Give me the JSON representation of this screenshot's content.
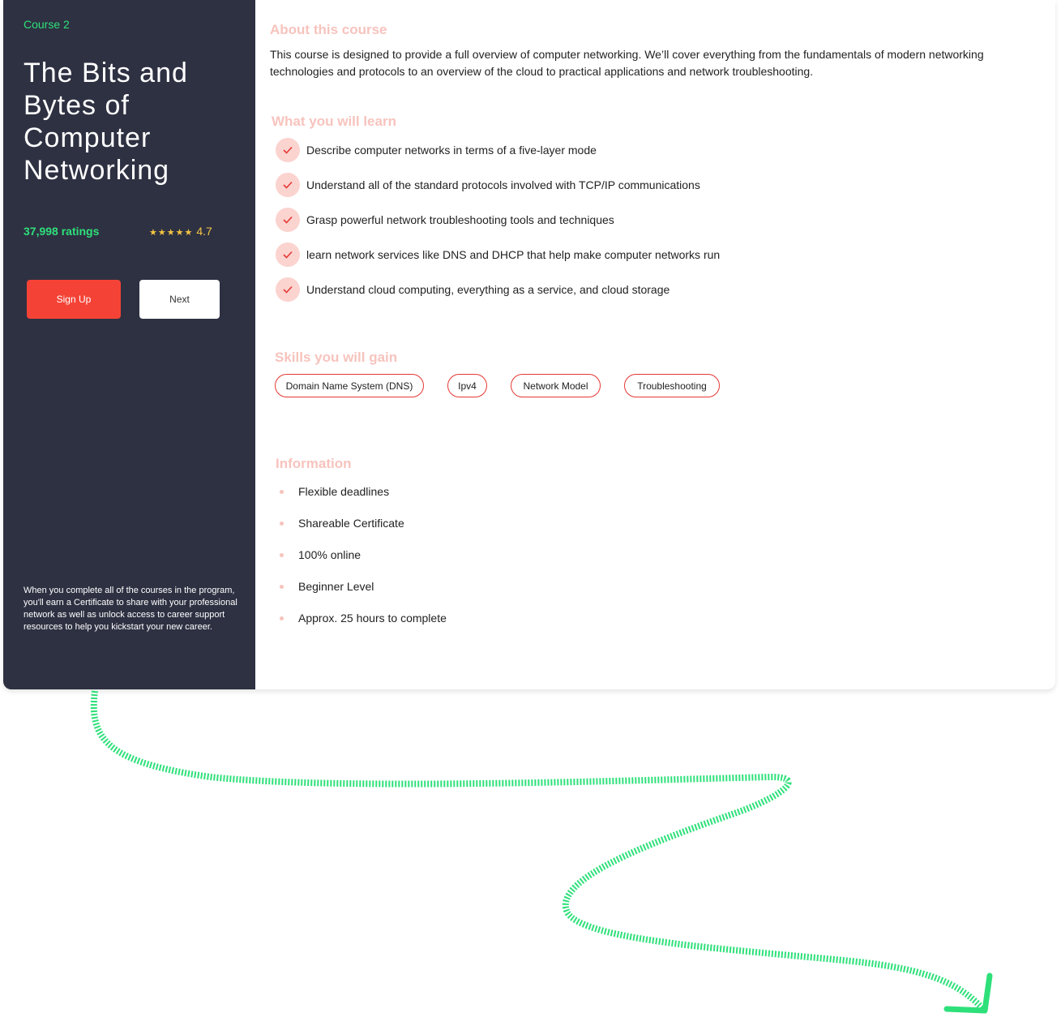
{
  "sidebar": {
    "course_label": "Course 2",
    "title": "The Bits and Bytes of Computer Networking",
    "ratings_count": "37,998 ratings",
    "stars": "★★★★★",
    "rating_value": "4.7",
    "signup_label": "Sign Up",
    "next_label": "Next",
    "footer_text": "When you complete all of the courses in the program, you'll earn a Certificate to share with your professional network as well as unlock access to career support resources to help you kickstart your new career."
  },
  "about": {
    "heading": "About this course",
    "text": "This course is designed to provide a full overview of computer networking. We’ll cover everything from the fundamentals of modern networking technologies and protocols to an overview of the cloud to practical applications and network troubleshooting."
  },
  "learn": {
    "heading": "What you will learn",
    "items": [
      "Describe computer networks in terms of a five-layer mode",
      "Understand all of the standard protocols involved with TCP/IP communications",
      "Grasp powerful network troubleshooting tools and techniques",
      "learn network services like DNS and DHCP that help make computer networks run",
      "Understand cloud computing, everything as a service, and cloud storage"
    ]
  },
  "skills": {
    "heading": "Skills you will gain",
    "items": [
      "Domain Name System (DNS)",
      "Ipv4",
      "Network Model",
      "Troubleshooting"
    ]
  },
  "information": {
    "heading": "Information",
    "items": [
      "Flexible deadlines",
      "Shareable Certificate",
      "100% online",
      "Beginner Level",
      "Approx. 25 hours to complete"
    ]
  },
  "colors": {
    "sidebar_bg": "#2e3142",
    "accent_green": "#2ee07a",
    "accent_red": "#f44336",
    "heading_pink": "#f7c3bd",
    "star_yellow": "#f5c542"
  },
  "icons": {
    "check": "check-icon",
    "arrow": "dashed-arrow"
  }
}
